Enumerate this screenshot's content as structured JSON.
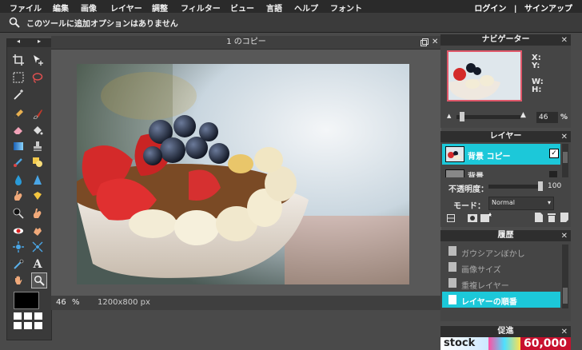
{
  "menu": {
    "items": [
      "ファイル",
      "編集",
      "画像",
      "レイヤー",
      "調整",
      "フィルター",
      "ビュー",
      "言語",
      "ヘルプ",
      "フォント"
    ],
    "login": "ログイン",
    "separator": "|",
    "signup": "サインアップ"
  },
  "options_bar": {
    "message": "このツールに追加オプションはありません"
  },
  "document": {
    "title": "1 のコピー",
    "zoom_value": "46",
    "zoom_unit": "%",
    "size": "1200x800 px"
  },
  "navigator": {
    "title": "ナビゲーター",
    "x_label": "X:",
    "y_label": "Y:",
    "w_label": "W:",
    "h_label": "H:",
    "zoom_value": "46",
    "zoom_unit": "%"
  },
  "layers": {
    "title": "レイヤー",
    "items": [
      {
        "name": "背景 コピー",
        "selected": true,
        "checked": true
      },
      {
        "name": "背景",
        "selected": false,
        "checked": true
      }
    ],
    "opacity_label": "不透明度：",
    "opacity_value": "100",
    "mode_label": "モード：",
    "mode_value": "Normal"
  },
  "history": {
    "title": "履歴",
    "items": [
      {
        "name": "ガウシアンぼかし",
        "selected": false
      },
      {
        "name": "画像サイズ",
        "selected": false
      },
      {
        "name": "重複レイヤー",
        "selected": false
      },
      {
        "name": "レイヤーの順番",
        "selected": true
      }
    ]
  },
  "promo": {
    "title": "促進",
    "brand": "stock",
    "number": "60,000"
  },
  "colors": {
    "accent": "#1cc8d9",
    "menubar": "#2a2a2a",
    "panel": "#454545",
    "foreground": "#000000",
    "background": "#ffffff"
  }
}
